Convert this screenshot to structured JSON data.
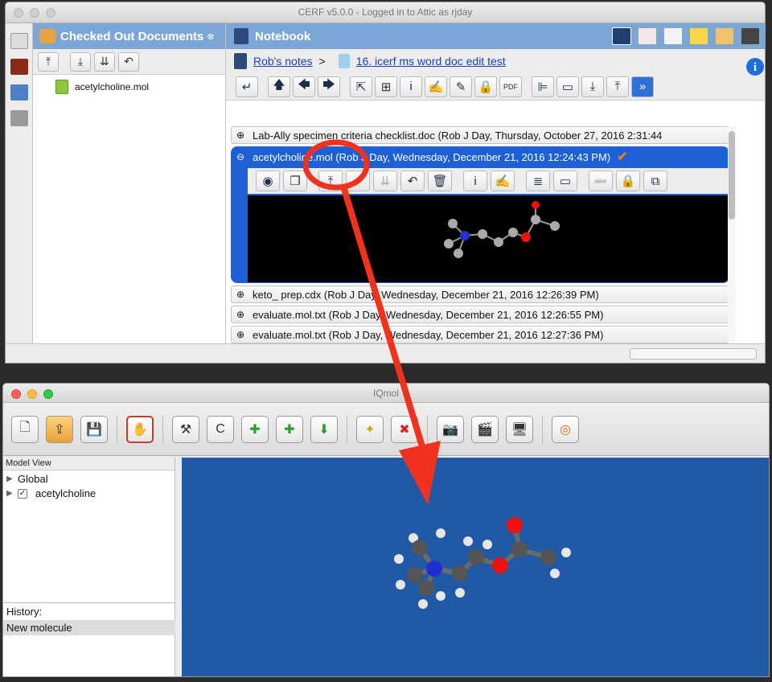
{
  "cerf": {
    "title": "CERF v5.0.0 - Logged in to Attic as rjday",
    "checked_out_tab": "Checked Out Documents",
    "checked_out_items": [
      "acetylcholine.mol"
    ],
    "notebook_tab": "Notebook",
    "breadcrumb": {
      "notebook": "Rob's notes",
      "separator": ">",
      "page": "16. icerf ms word doc edit test"
    },
    "entries": [
      {
        "text": "Lab-Ally specimen criteria checklist.doc (Rob J Day, Thursday, October 27, 2016 2:31:44",
        "expanded": false
      },
      {
        "text": "acetylcholine.mol (Rob J Day, Wednesday, December 21, 2016 12:24:43 PM)",
        "expanded": true
      },
      {
        "text": "keto_ prep.cdx (Rob J Day, Wednesday, December 21, 2016 12:26:39 PM)",
        "expanded": false
      },
      {
        "text": "evaluate.mol.txt (Rob J Day, Wednesday, December 21, 2016 12:26:55 PM)",
        "expanded": false
      },
      {
        "text": "evaluate.mol.txt (Rob J Day, Wednesday, December 21, 2016 12:27:36 PM)",
        "expanded": false
      }
    ],
    "icons": {
      "expand": "⊕",
      "collapse": "⊖",
      "check": "✔",
      "toolbar": [
        "enter-icon",
        "arrow-up-icon",
        "arrow-left-icon",
        "arrow-right-icon",
        "share-icon",
        "add-page-icon",
        "info-icon",
        "signature-icon",
        "pen-icon",
        "lock-icon",
        "pdf-icon",
        "align-icon",
        "fields-icon",
        "move-down-icon",
        "move-top-icon",
        "more-icon"
      ],
      "entry_toolbar": [
        "view-icon",
        "copy-icon",
        "upload-icon",
        "download-icon",
        "download-stack-icon",
        "undo-icon",
        "trash-icon",
        "info-icon",
        "signature-icon",
        "notes-icon",
        "card-icon",
        "strikethrough-icon",
        "lock-icon",
        "window-icon"
      ]
    }
  },
  "iqmol": {
    "title": "IQmol",
    "model_view_label": "Model View",
    "tree": [
      {
        "label": "Global",
        "checked": null
      },
      {
        "label": "acetylcholine",
        "checked": true
      }
    ],
    "history_label": "History:",
    "history_items": [
      "New molecule"
    ],
    "carbon_button": "C"
  },
  "colors": {
    "accent_blue": "#1d5fd4",
    "tab_blue": "#7da6d8",
    "viewport_blue": "#2059a6",
    "callout_red": "#f0321e"
  }
}
